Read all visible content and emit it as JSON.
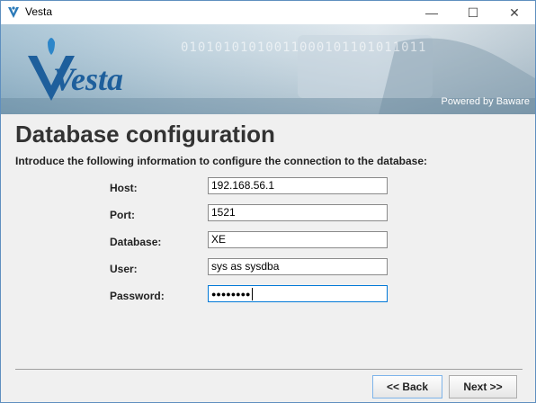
{
  "window": {
    "title": "Vesta",
    "controls": {
      "minimize": "—",
      "maximize": "☐",
      "close": "✕"
    }
  },
  "banner": {
    "logo_text": "Vesta",
    "binary_text": "01010101010011000101101011011",
    "powered_by": "Powered by Baware"
  },
  "page": {
    "heading": "Database configuration",
    "subtitle": "Introduce the following information to configure the connection to the database:"
  },
  "form": {
    "fields": [
      {
        "label": "Host:",
        "value": "192.168.56.1"
      },
      {
        "label": "Port:",
        "value": "1521"
      },
      {
        "label": "Database:",
        "value": "XE"
      },
      {
        "label": "User:",
        "value": "sys as sysdba"
      },
      {
        "label": "Password:",
        "value": "●●●●●●●●"
      }
    ]
  },
  "buttons": {
    "back": "<< Back",
    "next": "Next >>"
  },
  "colors": {
    "accent": "#1e6aa8",
    "banner_bg": "#9bb9cc",
    "heading": "#333333"
  }
}
